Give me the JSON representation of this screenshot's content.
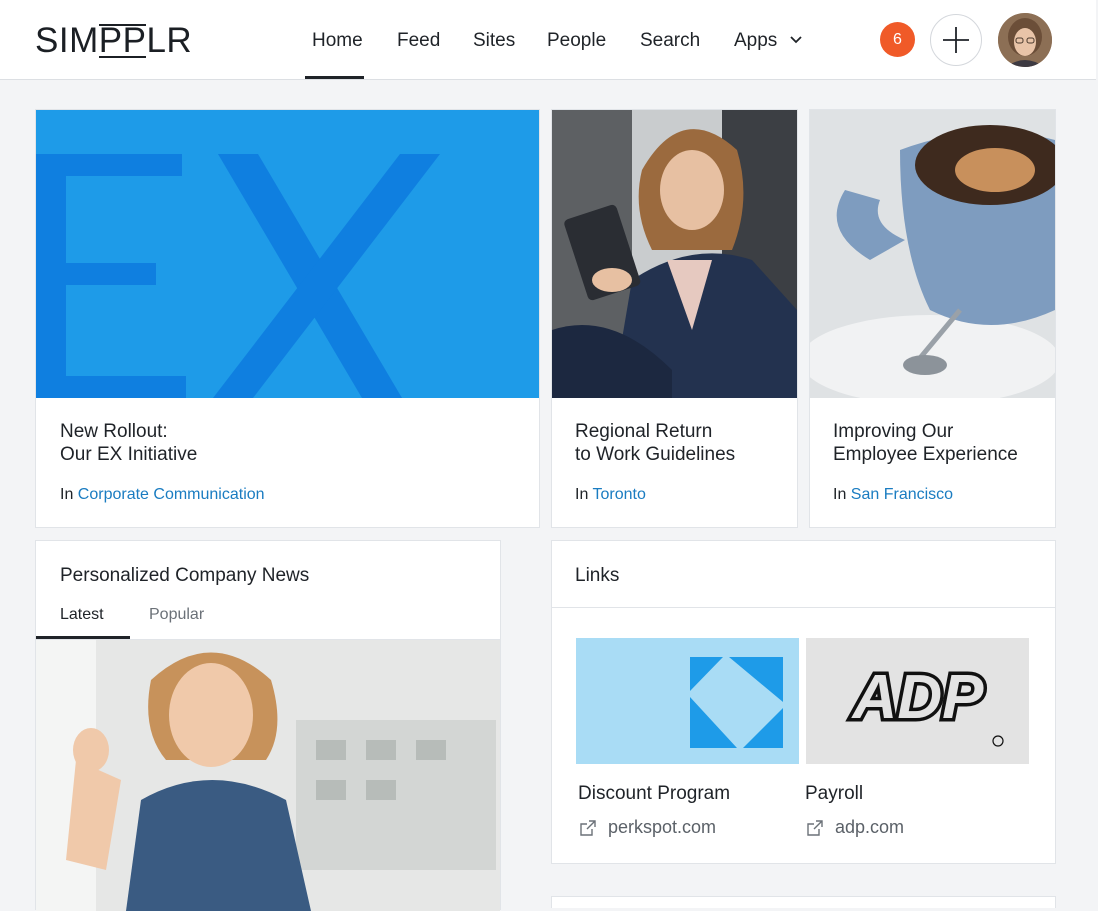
{
  "header": {
    "logo": {
      "pre": "SIM",
      "mid": "PP",
      "post": "LR"
    },
    "nav": [
      {
        "label": "Home",
        "active": true
      },
      {
        "label": "Feed"
      },
      {
        "label": "Sites"
      },
      {
        "label": "People"
      },
      {
        "label": "Search"
      },
      {
        "label": "Apps"
      }
    ],
    "notification_count": "6",
    "icons": {
      "add": "plus-icon",
      "apps_menu": "chevron-down-icon"
    },
    "colors": {
      "badge": "#f05a28"
    }
  },
  "featured": [
    {
      "title_line1": "New Rollout:",
      "title_line2": "Our EX Initiative",
      "prefix": "In",
      "site": "Corporate Communication",
      "image_text": "EX"
    },
    {
      "title_line1": "Regional Return",
      "title_line2": "to Work Guidelines",
      "prefix": "In",
      "site": "Toronto"
    },
    {
      "title_line1": "Improving Our",
      "title_line2": "Employee Experience",
      "prefix": "In",
      "site": "San Francisco"
    }
  ],
  "news": {
    "title": "Personalized Company News",
    "tabs": [
      {
        "label": "Latest",
        "active": true
      },
      {
        "label": "Popular"
      }
    ]
  },
  "links": {
    "title": "Links",
    "items": [
      {
        "name": "Discount Program",
        "url": "perkspot.com",
        "icon": "external-link-icon"
      },
      {
        "name": "Payroll",
        "url": "adp.com",
        "icon": "external-link-icon",
        "logo_text": "ADP"
      }
    ]
  },
  "colors": {
    "link": "#1a7cc1",
    "ex_bg": "#1e9be8",
    "ex_letters": "#0f7fe0",
    "perkspot_bg": "#a9dcf5",
    "perkspot_mark": "#1e9be8"
  }
}
